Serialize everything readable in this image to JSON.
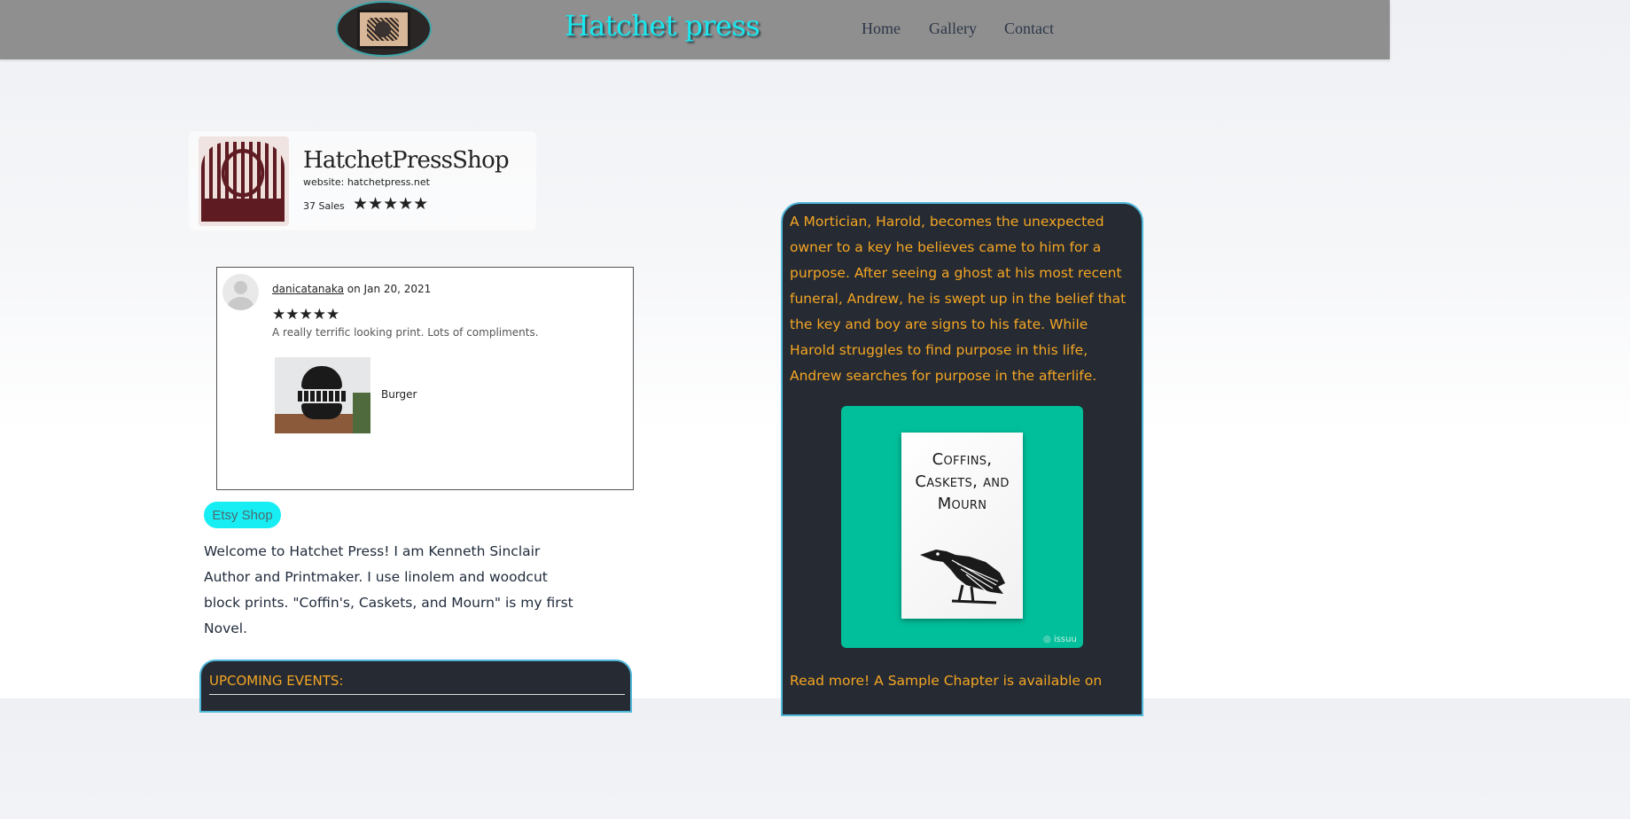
{
  "header": {
    "title": "Hatchet press",
    "nav": [
      {
        "label": "Home"
      },
      {
        "label": "Gallery"
      },
      {
        "label": "Contact"
      }
    ]
  },
  "shop": {
    "name": "HatchetPressShop",
    "website": "website: hatchetpress.net",
    "sales": "37 Sales",
    "stars": "★★★★★",
    "rating": 5
  },
  "review": {
    "user": "danicatanaka",
    "date": " on Jan 20, 2021",
    "stars": "★★★★★",
    "rating": 5,
    "text": "A really terrific looking print. Lots of compliments.",
    "product": "Burger"
  },
  "etsy_button": "Etsy Shop",
  "welcome": "Welcome to Hatchet Press! I am Kenneth Sinclair Author and Printmaker. I use linolem and woodcut block prints. \"Coffin's, Caskets, and Mourn\" is my first Novel.",
  "events": {
    "title": "UPCOMING EVENTS:"
  },
  "book": {
    "description": "A Mortician, Harold, becomes the unexpected owner to a key he believes came to him for a purpose. After seeing a ghost at his most recent funeral, Andrew, he is swept up in the belief that the key and boy are signs to his fate. While Harold struggles to find purpose in this life, Andrew searches for purpose in the afterlife.",
    "cover_title": "Coffins, Caskets, and Mourn",
    "embed_mark": "issuu",
    "read_more": "Read more! A Sample Chapter is available on"
  },
  "colors": {
    "header_bg": "#8f8f8f",
    "title": "#19e8ee",
    "panel_bg": "#252a33",
    "panel_border": "#4fb7d9",
    "accent_text": "#f5a623",
    "issuu_bg": "#00bf9a"
  }
}
